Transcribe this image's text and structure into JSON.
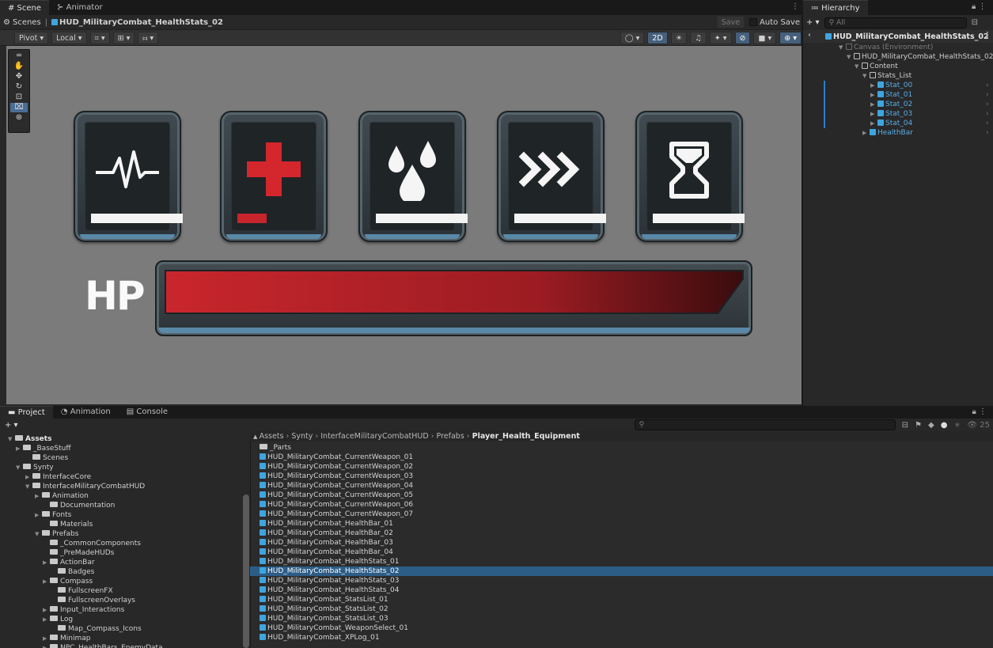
{
  "top_tabs": {
    "scene": "# Scene",
    "animator": "⊱ Animator"
  },
  "scene_crumb": {
    "scenes": "Scenes",
    "sep": "|",
    "prefab": "HUD_MilitaryCombat_HealthStats_02"
  },
  "scene_actions": {
    "save": "Save",
    "auto_save": "Auto Save"
  },
  "scene_toolbar": {
    "pivot": "Pivot ▾",
    "local": "Local ▾",
    "mode_2d": "2D"
  },
  "stats": [
    {
      "glyph": "heartbeat",
      "bar_fill": 1.0,
      "bar_color": "#f3f3f3"
    },
    {
      "glyph": "medical-cross",
      "bar_fill": 0.32,
      "bar_color": "#c8242b"
    },
    {
      "glyph": "water-drops",
      "bar_fill": 1.0,
      "bar_color": "#f3f3f3"
    },
    {
      "glyph": "triple-chevron",
      "bar_fill": 1.0,
      "bar_color": "#f3f3f3"
    },
    {
      "glyph": "hourglass",
      "bar_fill": 1.0,
      "bar_color": "#f3f3f3"
    }
  ],
  "hp": {
    "label": "HP",
    "fill": 1.0,
    "color": "#c02228"
  },
  "hierarchy": {
    "tab": "≔ Hierarchy",
    "search_placeholder": "All",
    "root": "HUD_MilitaryCombat_HealthStats_02",
    "rows": [
      {
        "label": "Canvas (Environment)",
        "style": "dim"
      },
      {
        "label": "HUD_MilitaryCombat_HealthStats_02",
        "style": "normal"
      },
      {
        "label": "Content",
        "style": "normal"
      },
      {
        "label": "Stats_List",
        "style": "normal"
      },
      {
        "label": "Stat_00",
        "style": "blue"
      },
      {
        "label": "Stat_01",
        "style": "blue"
      },
      {
        "label": "Stat_02",
        "style": "blue"
      },
      {
        "label": "Stat_03",
        "style": "blue"
      },
      {
        "label": "Stat_04",
        "style": "blue"
      },
      {
        "label": "HealthBar",
        "style": "blue"
      }
    ]
  },
  "bottom_tabs": {
    "project": "Project",
    "animation": "Animation",
    "console": "Console"
  },
  "project": {
    "add": "+ ▾",
    "hidden_count": "25",
    "tree": [
      {
        "label": "Assets",
        "bold": true
      },
      {
        "label": "_BaseStuff"
      },
      {
        "label": "Scenes"
      },
      {
        "label": "Synty"
      },
      {
        "label": "InterfaceCore"
      },
      {
        "label": "InterfaceMilitaryCombatHUD"
      },
      {
        "label": "Animation"
      },
      {
        "label": "Documentation"
      },
      {
        "label": "Fonts"
      },
      {
        "label": "Materials"
      },
      {
        "label": "Prefabs"
      },
      {
        "label": "_CommonComponents"
      },
      {
        "label": "_PreMadeHUDs"
      },
      {
        "label": "ActionBar"
      },
      {
        "label": "Badges"
      },
      {
        "label": "Compass"
      },
      {
        "label": "FullscreenFX"
      },
      {
        "label": "FullscreenOverlays"
      },
      {
        "label": "Input_Interactions"
      },
      {
        "label": "Log"
      },
      {
        "label": "Map_Compass_Icons"
      },
      {
        "label": "Minimap"
      },
      {
        "label": "NPC_HealthBars_EnemyData"
      }
    ],
    "breadcrumb": [
      "Assets",
      "Synty",
      "InterfaceMilitaryCombatHUD",
      "Prefabs",
      "Player_Health_Equipment"
    ],
    "files": [
      "_Parts",
      "HUD_MilitaryCombat_CurrentWeapon_01",
      "HUD_MilitaryCombat_CurrentWeapon_02",
      "HUD_MilitaryCombat_CurrentWeapon_03",
      "HUD_MilitaryCombat_CurrentWeapon_04",
      "HUD_MilitaryCombat_CurrentWeapon_05",
      "HUD_MilitaryCombat_CurrentWeapon_06",
      "HUD_MilitaryCombat_CurrentWeapon_07",
      "HUD_MilitaryCombat_HealthBar_01",
      "HUD_MilitaryCombat_HealthBar_02",
      "HUD_MilitaryCombat_HealthBar_03",
      "HUD_MilitaryCombat_HealthBar_04",
      "HUD_MilitaryCombat_HealthStats_01",
      "HUD_MilitaryCombat_HealthStats_02",
      "HUD_MilitaryCombat_HealthStats_03",
      "HUD_MilitaryCombat_HealthStats_04",
      "HUD_MilitaryCombat_StatsList_01",
      "HUD_MilitaryCombat_StatsList_02",
      "HUD_MilitaryCombat_StatsList_03",
      "HUD_MilitaryCombat_WeaponSelect_01",
      "HUD_MilitaryCombat_XPLog_01"
    ],
    "selected_file": "HUD_MilitaryCombat_HealthStats_02"
  },
  "colors": {
    "accent": "#2c5d87",
    "prefab_blue": "#3ea5de",
    "viewport": "#7b7b7b"
  }
}
